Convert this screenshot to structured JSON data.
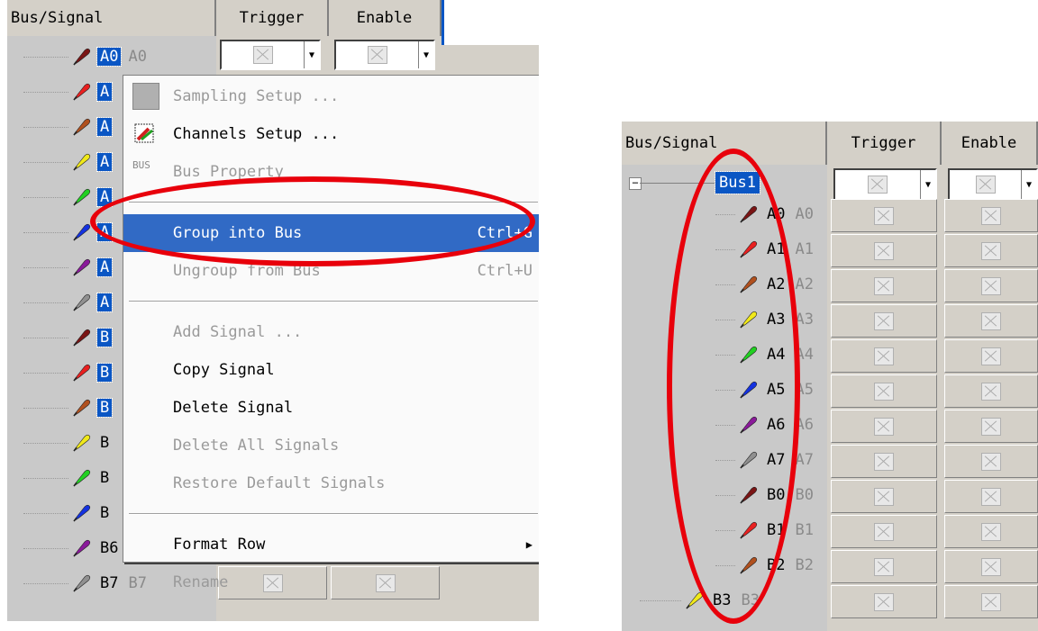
{
  "left": {
    "headers": {
      "bus_signal": "Bus/Signal",
      "trigger": "Trigger",
      "enable": "Enable"
    },
    "signals": [
      {
        "name": "A0",
        "ghost": "A0",
        "color": "#7a1414",
        "selected": true
      },
      {
        "name": "A",
        "ghost": "",
        "color": "#e82020",
        "selected": true
      },
      {
        "name": "A",
        "ghost": "",
        "color": "#b0501e",
        "selected": true
      },
      {
        "name": "A",
        "ghost": "",
        "color": "#f0e81a",
        "selected": true
      },
      {
        "name": "A",
        "ghost": "",
        "color": "#22d022",
        "selected": true
      },
      {
        "name": "A",
        "ghost": "",
        "color": "#1432e0",
        "selected": true
      },
      {
        "name": "A",
        "ghost": "",
        "color": "#8a1a9a",
        "selected": true
      },
      {
        "name": "A",
        "ghost": "",
        "color": "#909090",
        "selected": true
      },
      {
        "name": "B",
        "ghost": "",
        "color": "#7a1414",
        "selected": true
      },
      {
        "name": "B",
        "ghost": "",
        "color": "#e82020",
        "selected": true
      },
      {
        "name": "B",
        "ghost": "",
        "color": "#b0501e",
        "selected": true
      },
      {
        "name": "B",
        "ghost": "",
        "color": "#f0e81a",
        "selected": false
      },
      {
        "name": "B",
        "ghost": "",
        "color": "#22d022",
        "selected": false
      },
      {
        "name": "B",
        "ghost": "",
        "color": "#1432e0",
        "selected": false
      },
      {
        "name": "B6",
        "ghost": "B6",
        "color": "#8a1a9a",
        "selected": false
      },
      {
        "name": "B7",
        "ghost": "B7",
        "color": "#909090",
        "selected": false
      }
    ],
    "menu": [
      {
        "label": "Sampling Setup ...",
        "shortcut": "",
        "disabled": true,
        "icon": "sampling-setup-icon"
      },
      {
        "label": "Channels Setup ...",
        "shortcut": "",
        "disabled": false,
        "icon": "channels-setup-icon"
      },
      {
        "label": "Bus Property",
        "shortcut": "",
        "disabled": true,
        "icon": "bus-property-icon"
      },
      {
        "separator": true
      },
      {
        "label": "Group into Bus",
        "shortcut": "Ctrl+G",
        "disabled": false,
        "highlighted": true
      },
      {
        "label": "Ungroup from Bus",
        "shortcut": "Ctrl+U",
        "disabled": true
      },
      {
        "separator": true
      },
      {
        "label": "Add Signal ...",
        "shortcut": "",
        "disabled": true
      },
      {
        "label": "Copy Signal",
        "shortcut": "",
        "disabled": false
      },
      {
        "label": "Delete Signal",
        "shortcut": "",
        "disabled": false
      },
      {
        "label": "Delete All Signals",
        "shortcut": "",
        "disabled": true
      },
      {
        "label": "Restore Default Signals",
        "shortcut": "",
        "disabled": true
      },
      {
        "separator": true
      },
      {
        "label": "Format Row",
        "shortcut": "",
        "disabled": false,
        "submenu": true
      },
      {
        "label": "Rename",
        "shortcut": "",
        "disabled": true
      }
    ]
  },
  "right": {
    "headers": {
      "bus_signal": "Bus/Signal",
      "trigger": "Trigger",
      "enable": "Enable"
    },
    "bus": {
      "name": "Bus1",
      "collapse_glyph": "−"
    },
    "signals": [
      {
        "name": "A0",
        "ghost": "A0",
        "color": "#7a1414"
      },
      {
        "name": "A1",
        "ghost": "A1",
        "color": "#e82020"
      },
      {
        "name": "A2",
        "ghost": "A2",
        "color": "#b0501e"
      },
      {
        "name": "A3",
        "ghost": "A3",
        "color": "#f0e81a"
      },
      {
        "name": "A4",
        "ghost": "A4",
        "color": "#22d022"
      },
      {
        "name": "A5",
        "ghost": "A5",
        "color": "#1432e0"
      },
      {
        "name": "A6",
        "ghost": "A6",
        "color": "#8a1a9a"
      },
      {
        "name": "A7",
        "ghost": "A7",
        "color": "#909090"
      },
      {
        "name": "B0",
        "ghost": "B0",
        "color": "#7a1414"
      },
      {
        "name": "B1",
        "ghost": "B1",
        "color": "#e82020"
      },
      {
        "name": "B2",
        "ghost": "B2",
        "color": "#b0501e"
      },
      {
        "name": "B3",
        "ghost": "B3",
        "color": "#f0e81a"
      }
    ]
  },
  "annotation_color": "#e8000b"
}
